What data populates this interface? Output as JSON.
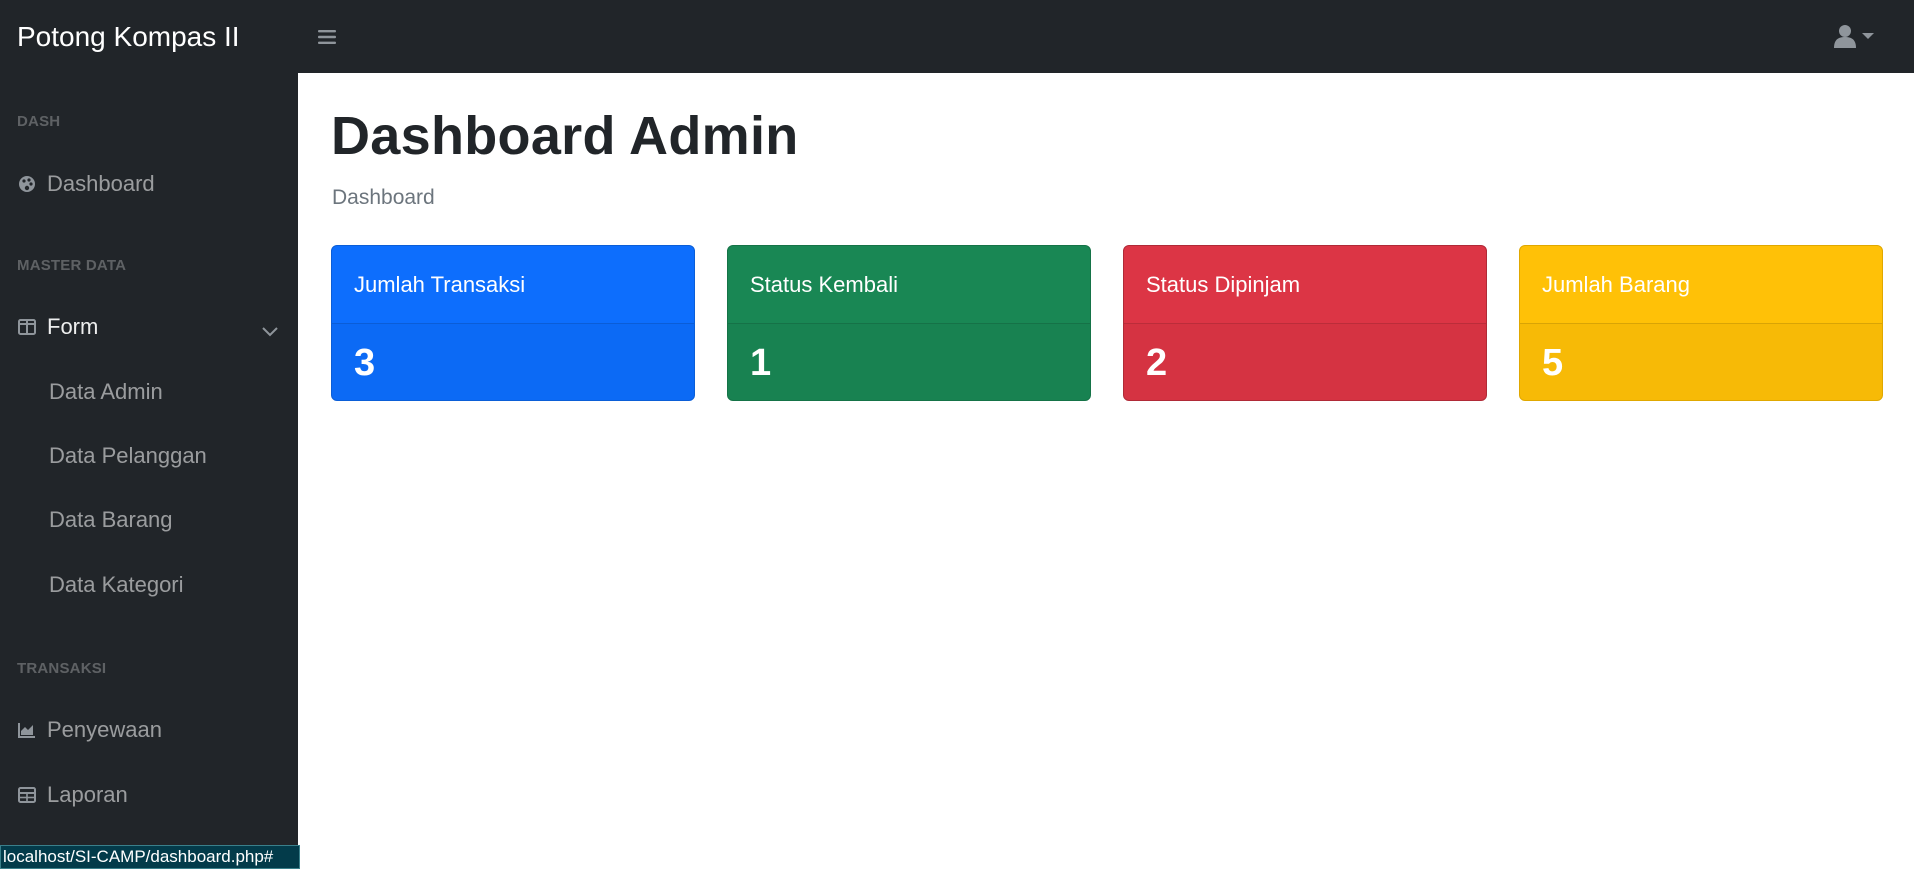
{
  "brand": "Potong Kompas II",
  "topbar": {
    "toggle_icon": "bars-icon",
    "user_icon": "user-icon"
  },
  "sidebar": {
    "sections": {
      "dash": "DASH",
      "master": "MASTER DATA",
      "transaksi": "TRANSAKSI"
    },
    "items": {
      "dashboard": "Dashboard",
      "form": "Form",
      "data_admin": "Data Admin",
      "data_pelanggan": "Data Pelanggan",
      "data_barang": "Data Barang",
      "data_kategori": "Data Kategori",
      "penyewaan": "Penyewaan",
      "laporan": "Laporan"
    }
  },
  "main": {
    "title": "Dashboard Admin",
    "breadcrumb": "Dashboard",
    "cards": [
      {
        "label": "Jumlah Transaksi",
        "value": "3",
        "color": "#0d6efd"
      },
      {
        "label": "Status Kembali",
        "value": "1",
        "color": "#198754"
      },
      {
        "label": "Status Dipinjam",
        "value": "2",
        "color": "#dc3545"
      },
      {
        "label": "Jumlah Barang",
        "value": "5",
        "color": "#ffc107"
      }
    ]
  },
  "statusbar": {
    "url": "localhost/SI-CAMP/dashboard.php#"
  }
}
